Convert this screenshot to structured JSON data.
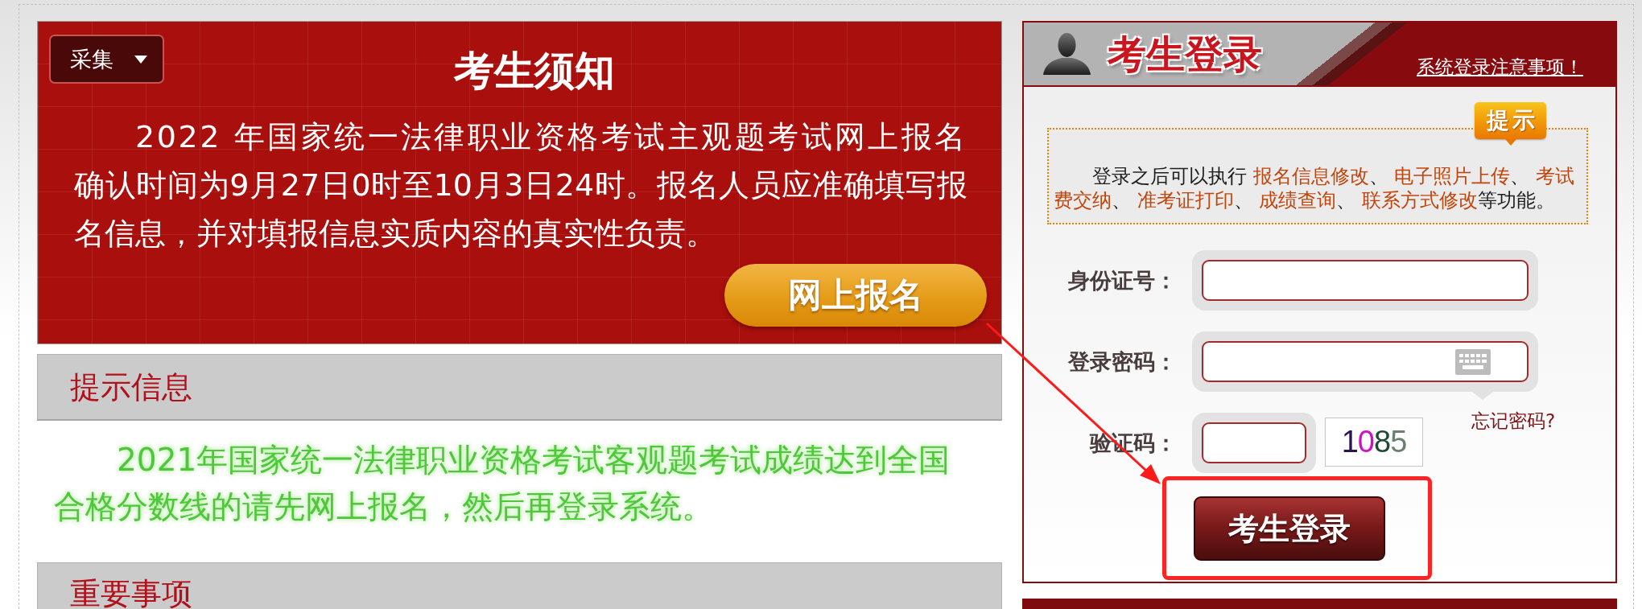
{
  "notice": {
    "menu_button": "采集",
    "title": "考生须知",
    "text": "2022 年国家统一法律职业资格考试主观题考试网上报名确认时间为9月27日0时至10月3日24时。报名人员应准确填写报名信息，并对填报信息实质内容的真实性负责。",
    "signup_button": "网上报名"
  },
  "sections": [
    {
      "title": "提示信息",
      "text": "2021年国家统一法律职业资格考试客观题考试成绩达到全国合格分数线的请先网上报名，然后再登录系统。"
    },
    {
      "title": "重要事项"
    }
  ],
  "login": {
    "title": "考生登录",
    "notice_link": "系统登录注意事项！",
    "hint_badge": "提示",
    "hint": [
      {
        "kind": "plain",
        "text": "登录之后可以执行 "
      },
      {
        "kind": "highlight",
        "text": "报名信息修改"
      },
      {
        "kind": "plain",
        "text": "、 "
      },
      {
        "kind": "highlight",
        "text": "电子照片上传"
      },
      {
        "kind": "plain",
        "text": "、 "
      },
      {
        "kind": "highlight",
        "text": "考试费交纳"
      },
      {
        "kind": "plain",
        "text": "、 "
      },
      {
        "kind": "highlight",
        "text": "准考证打印"
      },
      {
        "kind": "plain",
        "text": "、 "
      },
      {
        "kind": "highlight",
        "text": "成绩查询"
      },
      {
        "kind": "plain",
        "text": "、 "
      },
      {
        "kind": "highlight",
        "text": "联系方式修改"
      },
      {
        "kind": "plain",
        "text": "等功能。"
      }
    ],
    "fields": [
      {
        "kind": "text",
        "label": "身份证号："
      },
      {
        "kind": "password",
        "label": "登录密码："
      },
      {
        "kind": "captcha",
        "label": "验证码：",
        "captcha": "1085"
      }
    ],
    "forgot_link": "忘记密码?",
    "submit_button": "考生登录"
  },
  "annotations": {
    "arrow": true,
    "highlight_frame": true
  }
}
